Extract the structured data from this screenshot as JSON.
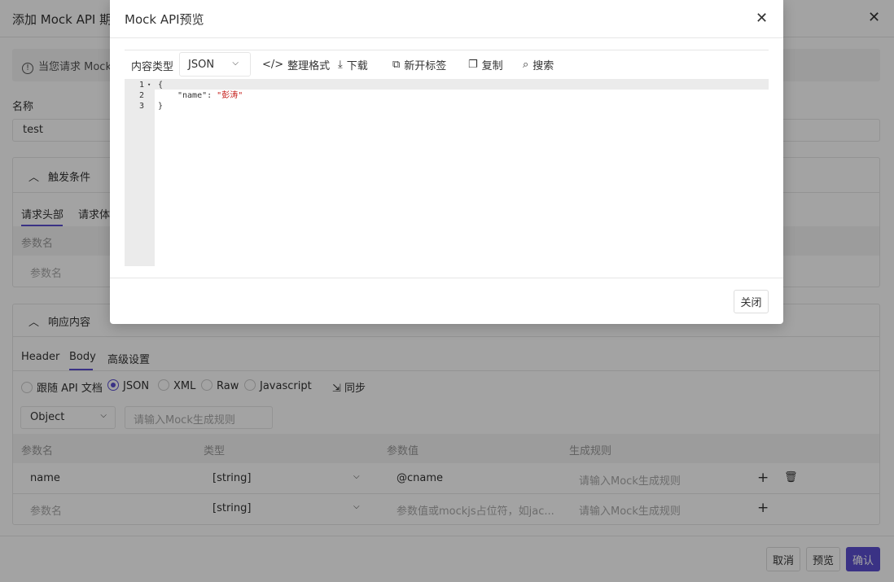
{
  "background": {
    "title": "添加 Mock API 期望",
    "alert_text": "当您请求 Mock API 时，会根据请求参数匹配期望",
    "name_label": "名称",
    "name_value": "test",
    "trigger_section": "触发条件",
    "trigger_tabs": [
      "请求头部",
      "请求体"
    ],
    "trigger_table_header": "参数名",
    "trigger_row_placeholder": "参数名",
    "response_section": "响应内容",
    "response_tabs": [
      "Header",
      "Body",
      "高级设置"
    ],
    "body_types": [
      "跟随 API 文档",
      "JSON",
      "XML",
      "Raw",
      "Javascript"
    ],
    "selected_body_type": "JSON",
    "sync_label": "同步",
    "root_type": "Object",
    "root_rule_placeholder": "请输入Mock生成规则",
    "columns": [
      "参数名",
      "类型",
      "参数值",
      "生成规则"
    ],
    "rows": [
      {
        "name": "name",
        "type": "[string]",
        "value": "@cname",
        "rule_placeholder": "请输入Mock生成规则"
      },
      {
        "name_placeholder": "参数名",
        "type": "[string]",
        "value_placeholder": "参数值或mockjs占位符，如jac...",
        "rule_placeholder": "请输入Mock生成规则"
      }
    ],
    "footer": {
      "cancel": "取消",
      "preview": "预览",
      "confirm": "确认"
    },
    "accent": "#5b4fd0"
  },
  "modal": {
    "title": "Mock API预览",
    "content_type_label": "内容类型",
    "content_type_value": "JSON",
    "toolbar": {
      "format": "整理格式",
      "download": "下载",
      "new_tab": "新开标签",
      "copy": "复制",
      "search": "搜索"
    },
    "code_lines": [
      {
        "num": "1",
        "text": "{"
      },
      {
        "num": "2",
        "key": "\"name\"",
        "sep": ": ",
        "value": "\"彭涛\""
      },
      {
        "num": "3",
        "text": "}"
      }
    ],
    "close_button": "关闭"
  }
}
